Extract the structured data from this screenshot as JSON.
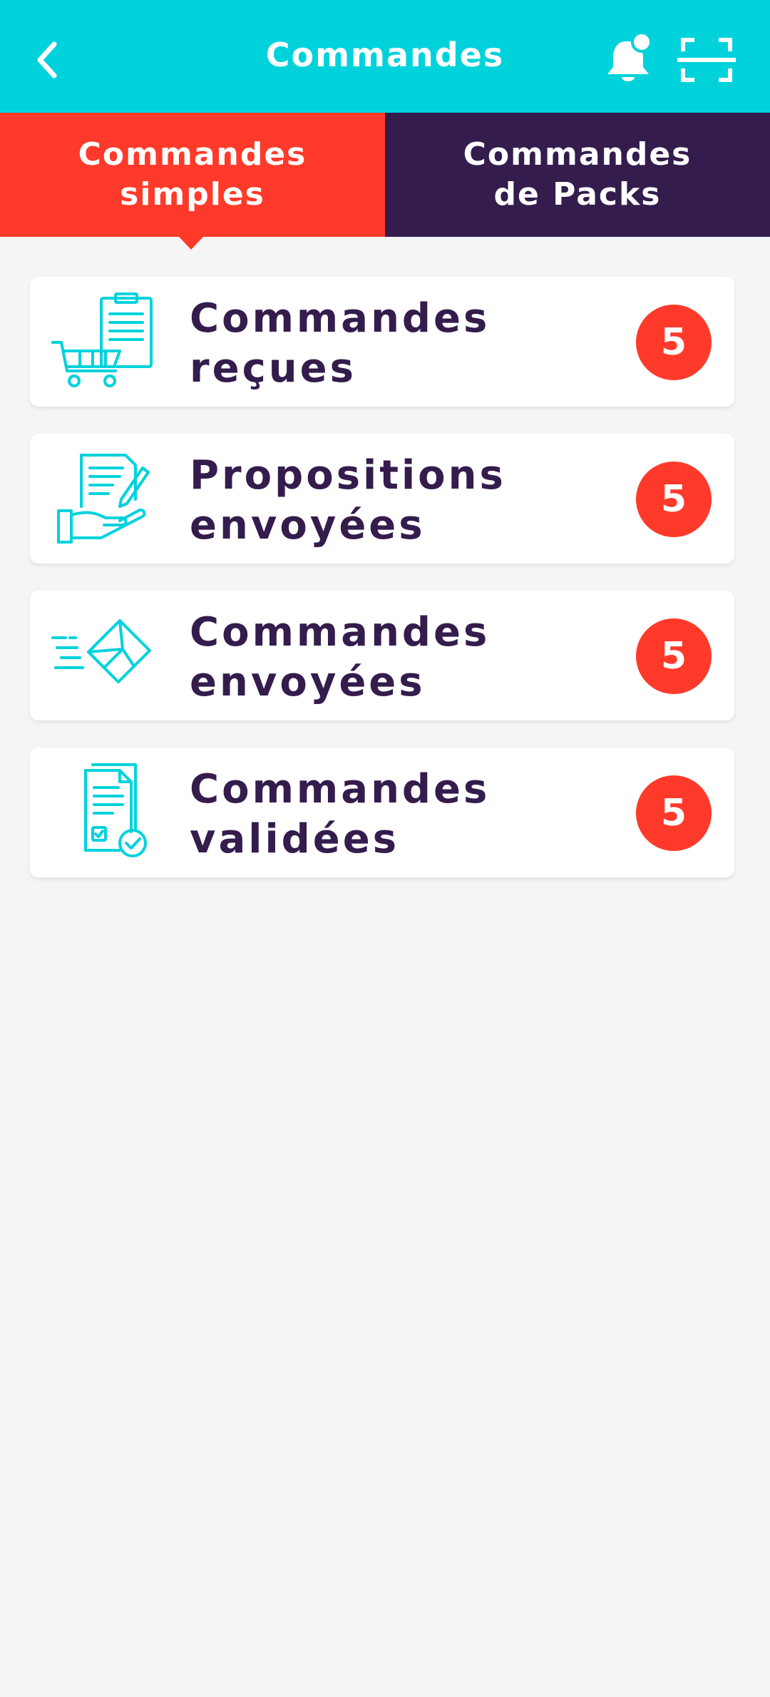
{
  "header": {
    "title": "Commandes",
    "back_icon": "chevron-left-icon",
    "notification_icon": "bell-icon",
    "scan_icon": "scan-icon"
  },
  "tabs": [
    {
      "line1": "Commandes",
      "line2": "simples",
      "active": true
    },
    {
      "line1": "Commandes",
      "line2": "de Packs",
      "active": false
    }
  ],
  "items": [
    {
      "line1": "Commandes",
      "line2": "reçues",
      "count": "5",
      "icon": "shopping-cart-list-icon"
    },
    {
      "line1": "Propositions",
      "line2": "envoyées",
      "count": "5",
      "icon": "proposal-hand-icon"
    },
    {
      "line1": "Commandes",
      "line2": "envoyées",
      "count": "5",
      "icon": "send-envelope-icon"
    },
    {
      "line1": "Commandes",
      "line2": "validées",
      "count": "5",
      "icon": "validated-document-icon"
    }
  ],
  "colors": {
    "header": "#00d2dc",
    "tab_active": "#ff3a2a",
    "tab_inactive": "#341c4d",
    "badge": "#ff3a2a",
    "text": "#341c4d",
    "icon": "#00d2dc",
    "background": "#f5f5f5"
  }
}
